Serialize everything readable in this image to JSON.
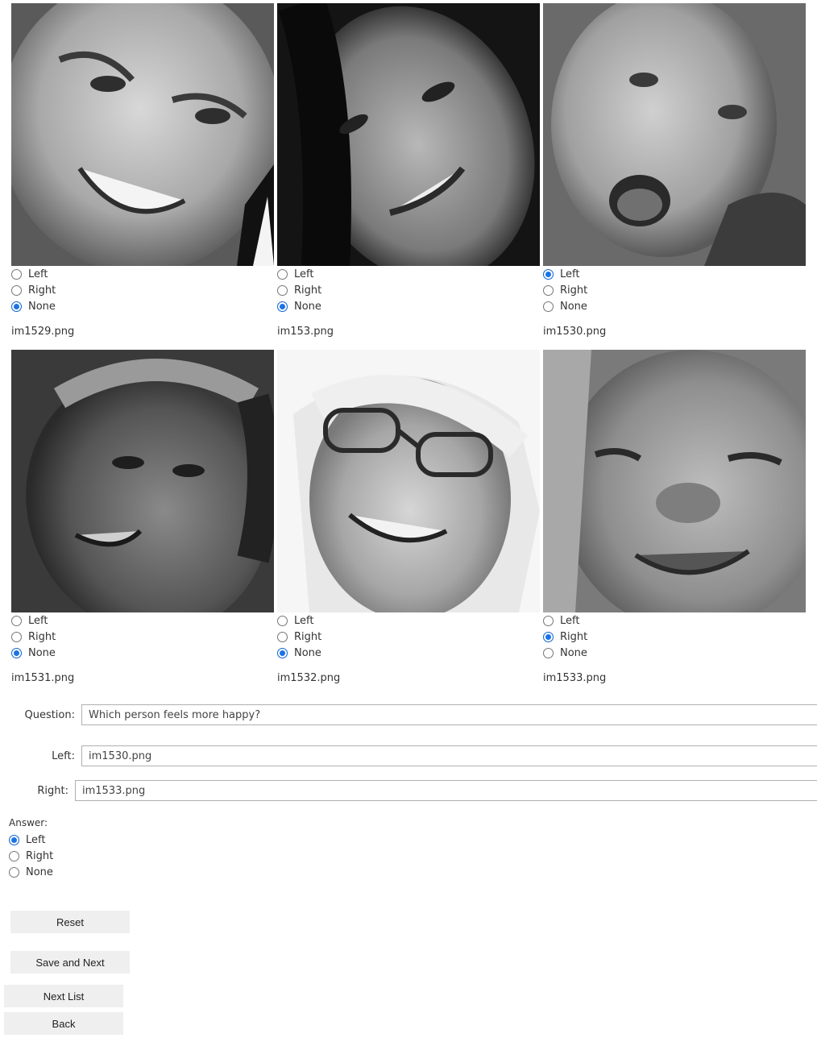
{
  "images": [
    {
      "filename": "im1529.png",
      "options": [
        "Left",
        "Right",
        "None"
      ],
      "selected": "None"
    },
    {
      "filename": "im153.png",
      "options": [
        "Left",
        "Right",
        "None"
      ],
      "selected": "None"
    },
    {
      "filename": "im1530.png",
      "options": [
        "Left",
        "Right",
        "None"
      ],
      "selected": "Left"
    },
    {
      "filename": "im1531.png",
      "options": [
        "Left",
        "Right",
        "None"
      ],
      "selected": "None"
    },
    {
      "filename": "im1532.png",
      "options": [
        "Left",
        "Right",
        "None"
      ],
      "selected": "None"
    },
    {
      "filename": "im1533.png",
      "options": [
        "Left",
        "Right",
        "None"
      ],
      "selected": "Right"
    }
  ],
  "form": {
    "question_label": "Question:",
    "question_value": "Which person feels more happy?",
    "left_label": "Left:",
    "left_value": "im1530.png",
    "right_label": "Right:",
    "right_value": "im1533.png"
  },
  "answer": {
    "title": "Answer:",
    "options": [
      "Left",
      "Right",
      "None"
    ],
    "selected": "Left"
  },
  "buttons": {
    "reset": "Reset",
    "save_next": "Save and Next",
    "next_list": "Next List",
    "back": "Back"
  },
  "colors": {
    "radio_checked": "#1a73e8",
    "button_bg": "#efefef"
  }
}
